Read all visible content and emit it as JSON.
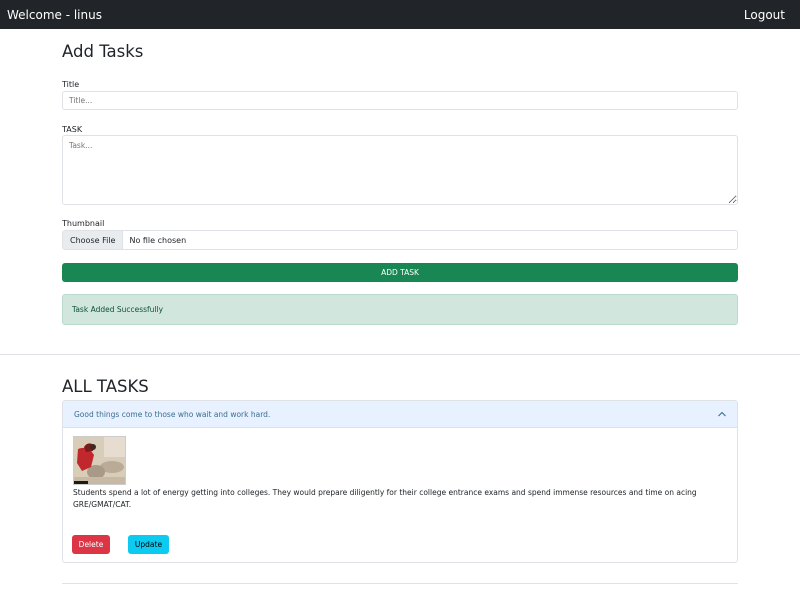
{
  "navbar": {
    "brand": "Welcome - linus",
    "logout_label": "Logout"
  },
  "add_form": {
    "heading": "Add Tasks",
    "title_label": "Title",
    "title_placeholder": "Title...",
    "task_label": "TASK",
    "task_placeholder": "Task...",
    "thumbnail_label": "Thumbnail",
    "choose_file_label": "Choose File",
    "no_file_text": "No file chosen",
    "submit_label": "ADD TASK"
  },
  "alert": {
    "message": "Task Added Successfully"
  },
  "tasks": {
    "heading": "ALL TASKS",
    "items": [
      {
        "title": "Good things come to those who wait and work hard.",
        "description": "Students spend a lot of energy getting into colleges. They would prepare diligently for their college entrance exams and spend immense resources and time on acing GRE/GMAT/CAT.",
        "delete_label": "Delete",
        "update_label": "Update"
      }
    ]
  },
  "colors": {
    "navbar": "#212529",
    "success": "#198754",
    "alert_bg": "#d1e7dd",
    "danger": "#dc3545",
    "info": "#0dcaf0",
    "accordion_head": "#e7f1ff"
  }
}
